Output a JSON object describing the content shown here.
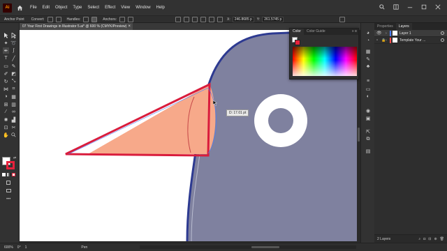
{
  "app": {
    "logo_text": "Ai",
    "menu": [
      "File",
      "Edit",
      "Object",
      "Type",
      "Select",
      "Effect",
      "View",
      "Window",
      "Help"
    ]
  },
  "control_bar": {
    "tool_name": "Anchor Point",
    "convert_label": "Convert:",
    "handles_label": "Handles:",
    "anchors_label": "Anchors:",
    "x_value": "246.8685 p",
    "y_value": "261.5745 p"
  },
  "document": {
    "tab_title": "07 Your First Drawings in Illustrator 5.ai* @ 600 % (CMYK/Preview)",
    "close_symbol": "×"
  },
  "canvas": {
    "measure_tooltip": "D: 17.01 pt",
    "colors": {
      "bird_body": "#7f819f",
      "bird_outline": "#2d3a91",
      "beak_fill": "#f7a98a",
      "beak_stroke": "#d91c3c",
      "eye_ring": "#ffffff",
      "eye_center": "#7f819f"
    }
  },
  "color_panel": {
    "tabs": [
      "Color",
      "Color Guide"
    ],
    "controls": "» ≡"
  },
  "layers_panel": {
    "tabs": [
      "Properties",
      "Layers"
    ],
    "layers": [
      {
        "name": "Layer 1",
        "color": "#4a7dff"
      },
      {
        "name": "Template Your ...",
        "color": "#ff4a4a"
      }
    ],
    "count": "2 Layers"
  },
  "status_bar": {
    "zoom": "600%",
    "rotation": "0°",
    "artboard": "1",
    "mode": "Pen"
  }
}
